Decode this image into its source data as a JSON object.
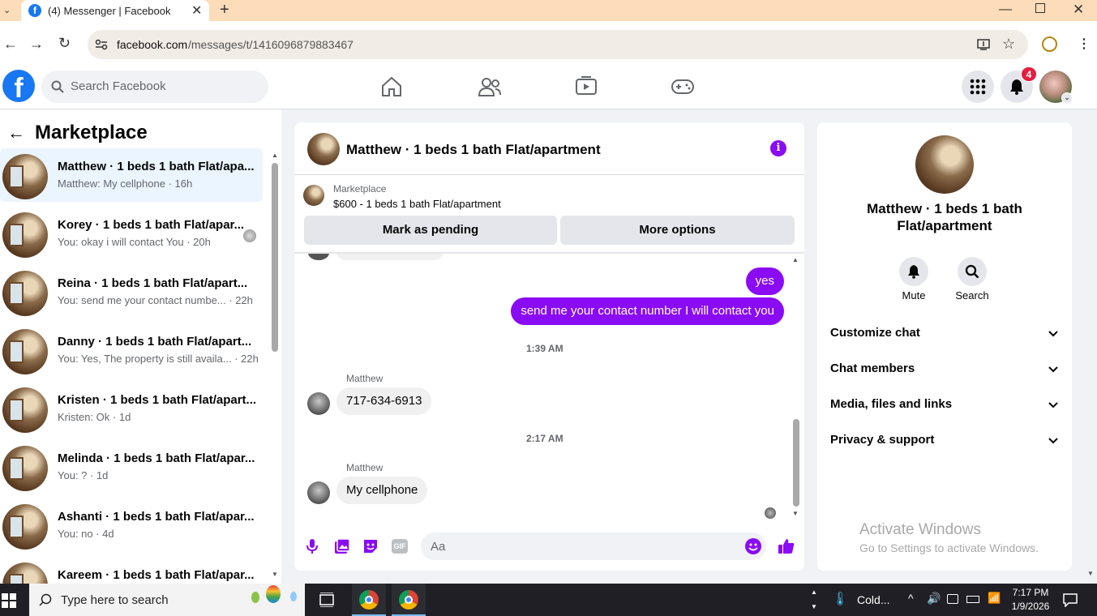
{
  "browser": {
    "tab_title": "(4) Messenger | Facebook",
    "url_domain": "facebook.com",
    "url_path": "/messages/t/1416096879883467"
  },
  "header": {
    "search_placeholder": "Search Facebook",
    "notification_count": "4"
  },
  "left": {
    "title": "Marketplace",
    "conversations": [
      {
        "name": "Matthew · 1 beds 1 bath Flat/apa...",
        "preview": "Matthew: My cellphone · 16h",
        "active": true
      },
      {
        "name": "Korey · 1 beds 1 bath Flat/apar...",
        "preview": "You: okay i will contact You · 20h"
      },
      {
        "name": "Reina · 1 beds 1 bath Flat/apart...",
        "preview": "You: send me your contact numbe... · 22h"
      },
      {
        "name": "Danny · 1 beds 1 bath Flat/apart...",
        "preview": "You: Yes, The property is still availa... · 22h"
      },
      {
        "name": "Kristen · 1 beds 1 bath Flat/apart...",
        "preview": "Kristen: Ok · 1d"
      },
      {
        "name": "Melinda · 1 beds 1 bath Flat/apar...",
        "preview": "You: ? · 1d"
      },
      {
        "name": "Ashanti · 1 beds 1 bath Flat/apar...",
        "preview": "You: no · 4d"
      },
      {
        "name": "Kareem · 1 beds 1 bath Flat/apar...",
        "preview": ""
      }
    ]
  },
  "chat": {
    "title": "Matthew · 1 beds 1 bath Flat/apartment",
    "listing_source": "Marketplace",
    "listing_text": "$600 - 1 beds 1 bath Flat/apartment",
    "btn_pending": "Mark as pending",
    "btn_more": "More options",
    "msg_out_1": "yes",
    "msg_out_2": "send me your contact number I will contact you",
    "time_1": "1:39 AM",
    "sender_1": "Matthew",
    "msg_in_1": "717-634-6913",
    "time_2": "2:17 AM",
    "sender_2": "Matthew",
    "msg_in_2": "My cellphone",
    "composer_placeholder": "Aa",
    "gif_label": "GIF"
  },
  "right": {
    "name": "Matthew · 1 beds 1 bath Flat/apartment",
    "mute_label": "Mute",
    "search_label": "Search",
    "sections": [
      "Customize chat",
      "Chat members",
      "Media, files and links",
      "Privacy & support"
    ],
    "watermark_title": "Activate Windows",
    "watermark_sub": "Go to Settings to activate Windows."
  },
  "taskbar": {
    "search_placeholder": "Type here to search",
    "weather": "Cold...",
    "time": "7:17 PM",
    "date": "1/9/2026"
  },
  "colors": {
    "accent_purple": "#8a0cf4",
    "fb_blue": "#1877f2",
    "badge_red": "#e41e3f"
  }
}
